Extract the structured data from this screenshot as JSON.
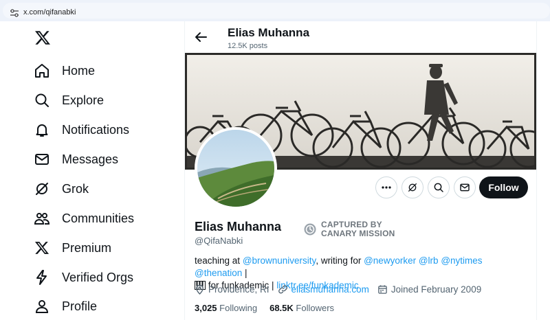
{
  "browser": {
    "url": "x.com/qifanabki"
  },
  "sidebar": {
    "items": [
      {
        "label": "Home",
        "icon": "home-icon"
      },
      {
        "label": "Explore",
        "icon": "search-icon"
      },
      {
        "label": "Notifications",
        "icon": "bell-icon"
      },
      {
        "label": "Messages",
        "icon": "envelope-icon"
      },
      {
        "label": "Grok",
        "icon": "grok-icon"
      },
      {
        "label": "Communities",
        "icon": "people-icon"
      },
      {
        "label": "Premium",
        "icon": "x-logo-icon"
      },
      {
        "label": "Verified Orgs",
        "icon": "lightning-icon"
      },
      {
        "label": "Profile",
        "icon": "person-icon"
      }
    ]
  },
  "header": {
    "name": "Elias Muhanna",
    "posts": "12.5K posts"
  },
  "profile": {
    "name": "Elias Muhanna",
    "handle": "@QifaNabki",
    "badge_line1": "CAPTURED BY",
    "badge_line2": "CANARY MISSION",
    "follow_label": "Follow",
    "bio": {
      "t1": "teaching at ",
      "l1": "@brownuniversity",
      "t2": ", writing for ",
      "l2": "@newyorker",
      "l3": "@lrb",
      "l4": "@nytimes",
      "l5": "@thenation",
      "t3": " |",
      "t4": " for funkademic | ",
      "l6": "linktr.ee/funkademic"
    },
    "location": "Providence, RI",
    "website": "eliasmuhanna.com",
    "joined": "Joined February 2009",
    "following_count": "3,025",
    "following_label": "Following",
    "followers_count": "68.5K",
    "followers_label": "Followers"
  },
  "colors": {
    "accent": "#1d9bf0",
    "text": "#0f1419",
    "muted": "#536471",
    "button_dark": "#0f1419"
  }
}
